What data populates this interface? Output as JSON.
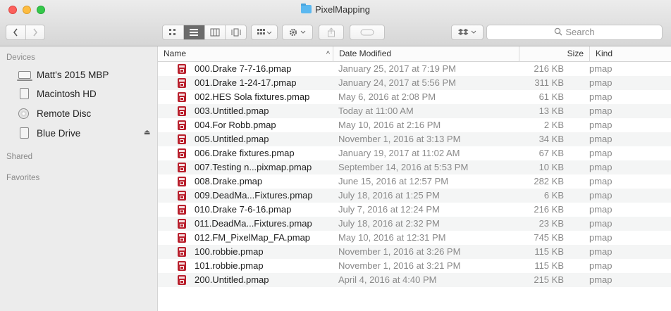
{
  "window": {
    "title": "PixelMapping"
  },
  "toolbar": {
    "search_placeholder": "Search",
    "view_icons": [
      "icon-view-icon",
      "list-view-icon",
      "column-view-icon",
      "cover-flow-icon"
    ],
    "group_icon": "arrange-icon",
    "action_icon": "gear-icon",
    "share_icon": "share-icon",
    "tag_icon": "tag-icon",
    "dropbox_icon": "dropbox-icon"
  },
  "sidebar": {
    "sections": {
      "devices": "Devices",
      "shared": "Shared",
      "favorites": "Favorites"
    },
    "devices": [
      {
        "label": "Matt's 2015 MBP",
        "icon": "laptop-icon"
      },
      {
        "label": "Macintosh HD",
        "icon": "hard-drive-icon"
      },
      {
        "label": "Remote Disc",
        "icon": "disc-icon"
      },
      {
        "label": "Blue Drive",
        "icon": "external-drive-icon",
        "eject": "⏏"
      }
    ]
  },
  "columns": {
    "name": "Name",
    "date": "Date Modified",
    "size": "Size",
    "kind": "Kind",
    "sort_indicator": "^"
  },
  "files": [
    {
      "name": "000.Drake 7-7-16.pmap",
      "date": "January 25, 2017 at 7:19 PM",
      "size": "216 KB",
      "kind": "pmap"
    },
    {
      "name": "001.Drake 1-24-17.pmap",
      "date": "January 24, 2017 at 5:56 PM",
      "size": "311 KB",
      "kind": "pmap"
    },
    {
      "name": "002.HES Sola fixtures.pmap",
      "date": "May 6, 2016 at 2:08 PM",
      "size": "61 KB",
      "kind": "pmap"
    },
    {
      "name": "003.Untitled.pmap",
      "date": "Today at 11:00 AM",
      "size": "13 KB",
      "kind": "pmap"
    },
    {
      "name": "004.For Robb.pmap",
      "date": "May 10, 2016 at 2:16 PM",
      "size": "2 KB",
      "kind": "pmap"
    },
    {
      "name": "005.Untitled.pmap",
      "date": "November 1, 2016 at 3:13 PM",
      "size": "34 KB",
      "kind": "pmap"
    },
    {
      "name": "006.Drake fixtures.pmap",
      "date": "January 19, 2017 at 11:02 AM",
      "size": "67 KB",
      "kind": "pmap"
    },
    {
      "name": "007.Testing n...pixmap.pmap",
      "date": "September 14, 2016 at 5:53 PM",
      "size": "10 KB",
      "kind": "pmap"
    },
    {
      "name": "008.Drake.pmap",
      "date": "June 15, 2016 at 12:57 PM",
      "size": "282 KB",
      "kind": "pmap"
    },
    {
      "name": "009.DeadMa...Fixtures.pmap",
      "date": "July 18, 2016 at 1:25 PM",
      "size": "6 KB",
      "kind": "pmap"
    },
    {
      "name": "010.Drake 7-6-16.pmap",
      "date": "July 7, 2016 at 12:24 PM",
      "size": "216 KB",
      "kind": "pmap"
    },
    {
      "name": "011.DeadMa...Fixtures.pmap",
      "date": "July 18, 2016 at 2:32 PM",
      "size": "23 KB",
      "kind": "pmap"
    },
    {
      "name": "012.FM_PixelMap_FA.pmap",
      "date": "May 10, 2016 at 12:31 PM",
      "size": "745 KB",
      "kind": "pmap"
    },
    {
      "name": "100.robbie.pmap",
      "date": "November 1, 2016 at 3:26 PM",
      "size": "115 KB",
      "kind": "pmap"
    },
    {
      "name": "101.robbie.pmap",
      "date": "November 1, 2016 at 3:21 PM",
      "size": "115 KB",
      "kind": "pmap"
    },
    {
      "name": "200.Untitled.pmap",
      "date": "April 4, 2016 at 4:40 PM",
      "size": "215 KB",
      "kind": "pmap"
    }
  ]
}
